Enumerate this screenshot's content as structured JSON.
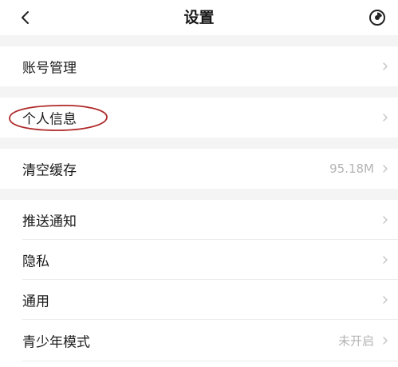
{
  "header": {
    "title": "设置",
    "back_icon": "chevron-left-icon",
    "right_icon": "theme-mode-icon"
  },
  "sections": [
    {
      "items": [
        {
          "label": "账号管理",
          "value": "",
          "icon": "chevron-right-icon"
        }
      ]
    },
    {
      "items": [
        {
          "label": "个人信息",
          "value": "",
          "icon": "chevron-right-icon"
        }
      ]
    },
    {
      "items": [
        {
          "label": "清空缓存",
          "value": "95.18M",
          "icon": "chevron-right-icon"
        }
      ]
    },
    {
      "items": [
        {
          "label": "推送通知",
          "value": "",
          "icon": "chevron-right-icon"
        },
        {
          "label": "隐私",
          "value": "",
          "icon": "chevron-right-icon"
        },
        {
          "label": "通用",
          "value": "",
          "icon": "chevron-right-icon"
        },
        {
          "label": "青少年模式",
          "value": "未开启",
          "icon": "chevron-right-icon"
        }
      ]
    }
  ],
  "colors": {
    "background": "#ffffff",
    "section_gap": "#f4f4f4",
    "text_primary": "#1b1b1b",
    "text_secondary": "#b4b4b4",
    "annotation": "#b02a2a"
  }
}
